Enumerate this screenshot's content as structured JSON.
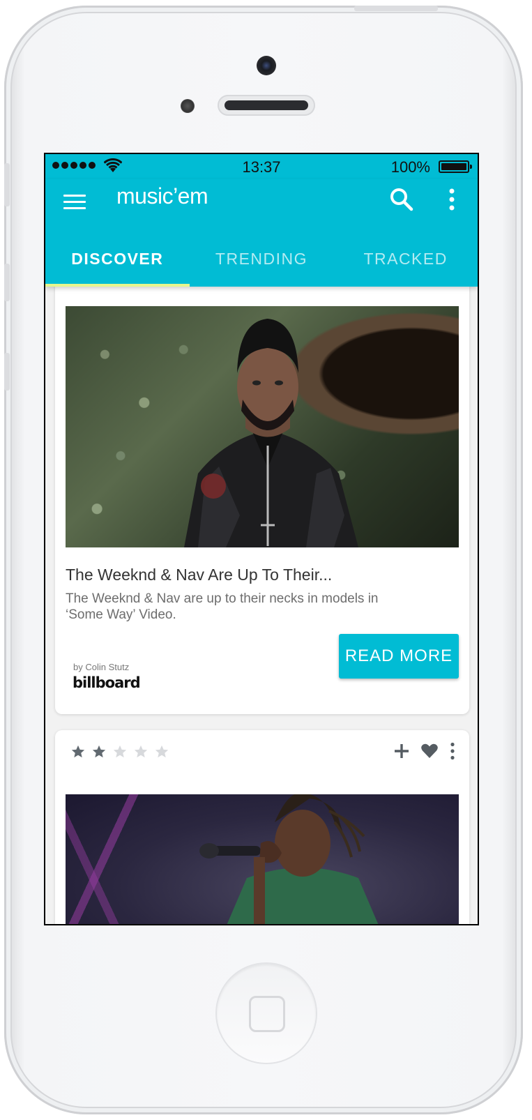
{
  "status_bar": {
    "time": "13:37",
    "battery": "100%"
  },
  "app_bar": {
    "title": "music’em"
  },
  "tabs": [
    {
      "label": "DISCOVER",
      "active": true
    },
    {
      "label": "TRENDING",
      "active": false
    },
    {
      "label": "TRACKED",
      "active": false
    }
  ],
  "cards": [
    {
      "title": "The Weeknd & Nav Are Up To Their...",
      "description": "The Weeknd & Nav are up to their necks in models in ‘Some Way’ Video.",
      "byline": "by Colin Stutz",
      "source": "billboard",
      "button": "READ MORE"
    },
    {
      "rating": {
        "value": 2,
        "max": 5
      }
    }
  ],
  "colors": {
    "primary": "#01bcd4",
    "tab_indicator": "#e6f68e",
    "card": "#ffffff"
  },
  "icons": [
    "menu-icon",
    "search-icon",
    "more-vert-icon",
    "star-icon",
    "plus-icon",
    "heart-icon"
  ]
}
